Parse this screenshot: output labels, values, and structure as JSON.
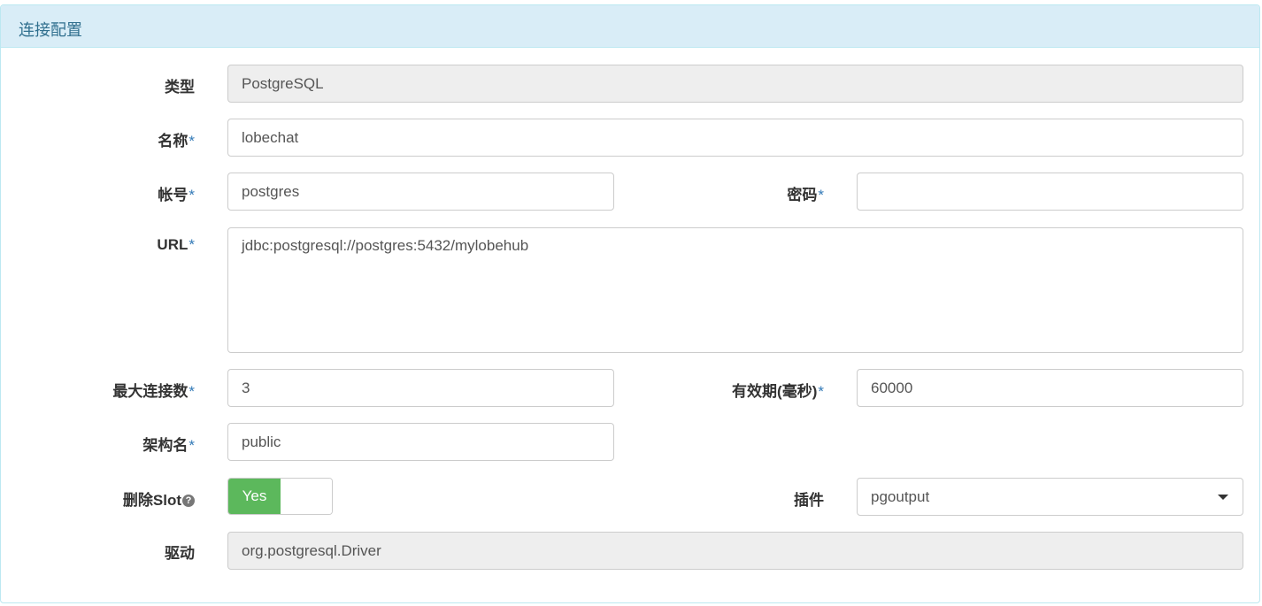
{
  "panel": {
    "title": "连接配置"
  },
  "form": {
    "type": {
      "label": "类型",
      "value": "PostgreSQL"
    },
    "name": {
      "label": "名称",
      "required": "*",
      "value": "lobechat"
    },
    "account": {
      "label": "帐号",
      "required": "*",
      "value": "postgres"
    },
    "password": {
      "label": "密码",
      "required": "*",
      "value": ""
    },
    "url": {
      "label": "URL",
      "required": "*",
      "value": "jdbc:postgresql://postgres:5432/mylobehub"
    },
    "max_connections": {
      "label": "最大连接数",
      "required": "*",
      "value": "3"
    },
    "expiry": {
      "label": "有效期(毫秒)",
      "required": "*",
      "value": "60000"
    },
    "schema": {
      "label": "架构名",
      "required": "*",
      "value": "public"
    },
    "delete_slot": {
      "label": "删除Slot",
      "help_icon": "question-circle-icon",
      "help_glyph": "?",
      "toggle_label": "Yes"
    },
    "plugin": {
      "label": "插件",
      "value": "pgoutput",
      "icon": "caret-down-icon"
    },
    "driver": {
      "label": "驱动",
      "value": "org.postgresql.Driver"
    }
  },
  "colors": {
    "heading_bg": "#d9edf7",
    "heading_text": "#31708f",
    "border": "#bce8f1",
    "required": "#337ab7",
    "toggle_on": "#5cb85c",
    "readonly_bg": "#eeeeee"
  }
}
